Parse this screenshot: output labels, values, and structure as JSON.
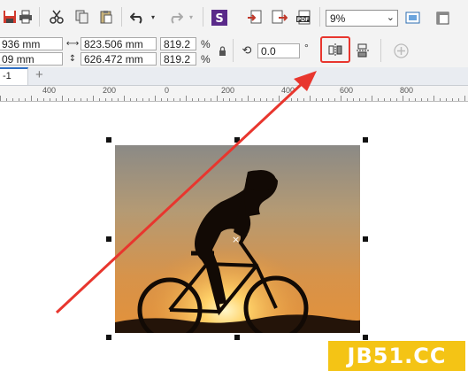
{
  "toolbar": {
    "zoom_value": "9%",
    "icons": [
      "save-icon",
      "print-icon",
      "cut-icon",
      "copy-icon",
      "paste-icon",
      "undo-icon",
      "redo-icon",
      "corel-connect-icon",
      "import-icon",
      "export-icon",
      "export-pdf-icon",
      "zoom-icon",
      "full-screen-icon",
      "snap-icon"
    ]
  },
  "property_bar": {
    "x_position": "936 mm",
    "y_position": "09 mm",
    "width": "823.506 mm",
    "height": "626.472 mm",
    "scale_x": "819.2",
    "scale_y": "819.2",
    "percent_symbol": "%",
    "rotation": "0.0",
    "degree_symbol": "°"
  },
  "page_tab": {
    "label": "-1",
    "add_symbol": "+"
  },
  "ruler": {
    "labels": [
      "400",
      "200",
      "0",
      "200",
      "400",
      "600",
      "800"
    ]
  },
  "annotation": {
    "highlight_color": "#e8362e",
    "arrow_color": "#e8362e"
  },
  "watermark": {
    "text": "JB51.CC",
    "color": "#f4c415"
  }
}
